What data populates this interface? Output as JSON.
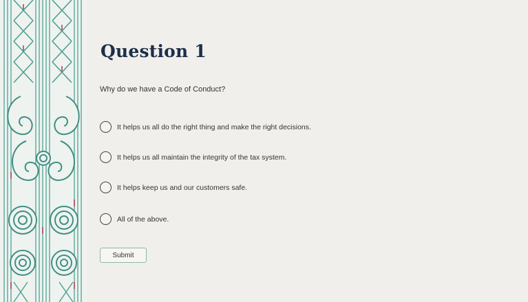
{
  "question": {
    "title": "Question 1",
    "prompt": "Why do we have a Code of Conduct?",
    "options": [
      {
        "label": "It helps us all do the right thing and make the right decisions."
      },
      {
        "label": "It helps us all maintain the integrity of the tax system."
      },
      {
        "label": "It helps keep us and our customers safe."
      },
      {
        "label": "All of the above."
      }
    ]
  },
  "submit_label": "Submit",
  "colors": {
    "background": "#f0efeb",
    "pattern_teal": "#4e9e90",
    "pattern_red": "#b0465a",
    "title": "#1d2f4a"
  },
  "icons": {
    "decoration": "kowhaiwhai-pattern",
    "option_marker": "radio-button-circle"
  }
}
